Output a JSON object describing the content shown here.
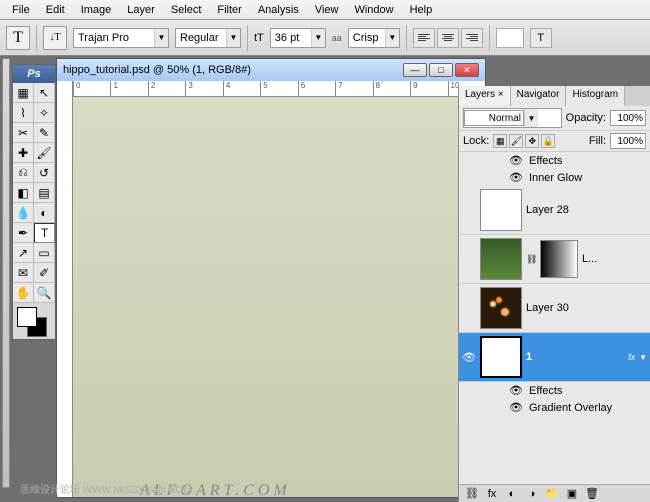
{
  "menu": [
    "File",
    "Edit",
    "Image",
    "Layer",
    "Select",
    "Filter",
    "Analysis",
    "View",
    "Window",
    "Help"
  ],
  "opt": {
    "tool_glyph": "T",
    "orient_glyph": "↓T",
    "font": "Trajan Pro",
    "weight": "Regular",
    "size_glyph": "tT",
    "size": "36 pt",
    "aa_label": "aa",
    "aa": "Crisp"
  },
  "toolbox": {
    "head": "Ps"
  },
  "doc": {
    "title": "hippo_tutorial.psd @ 50% (1, RGB/8#)",
    "ruler": [
      "0",
      "1",
      "2",
      "3",
      "4",
      "5",
      "6",
      "7",
      "8",
      "9",
      "10"
    ]
  },
  "panel": {
    "tabs": [
      "Layers ×",
      "Navigator",
      "Histogram"
    ],
    "blend": "Normal",
    "opacity_label": "Opacity:",
    "opacity": "100%",
    "lock_label": "Lock:",
    "fill_label": "Fill:",
    "fill": "100%",
    "effects": "Effects",
    "inner_glow": "Inner Glow",
    "gradient_overlay": "Gradient Overlay",
    "layers": {
      "l28": "Layer 28",
      "lL": "L...",
      "l30": "Layer 30",
      "l1": "1"
    },
    "fx": "fx"
  },
  "watermark": "ALFOART.COM",
  "wm2": "思缘设计论坛  WWW.MISSYUAN.COM"
}
